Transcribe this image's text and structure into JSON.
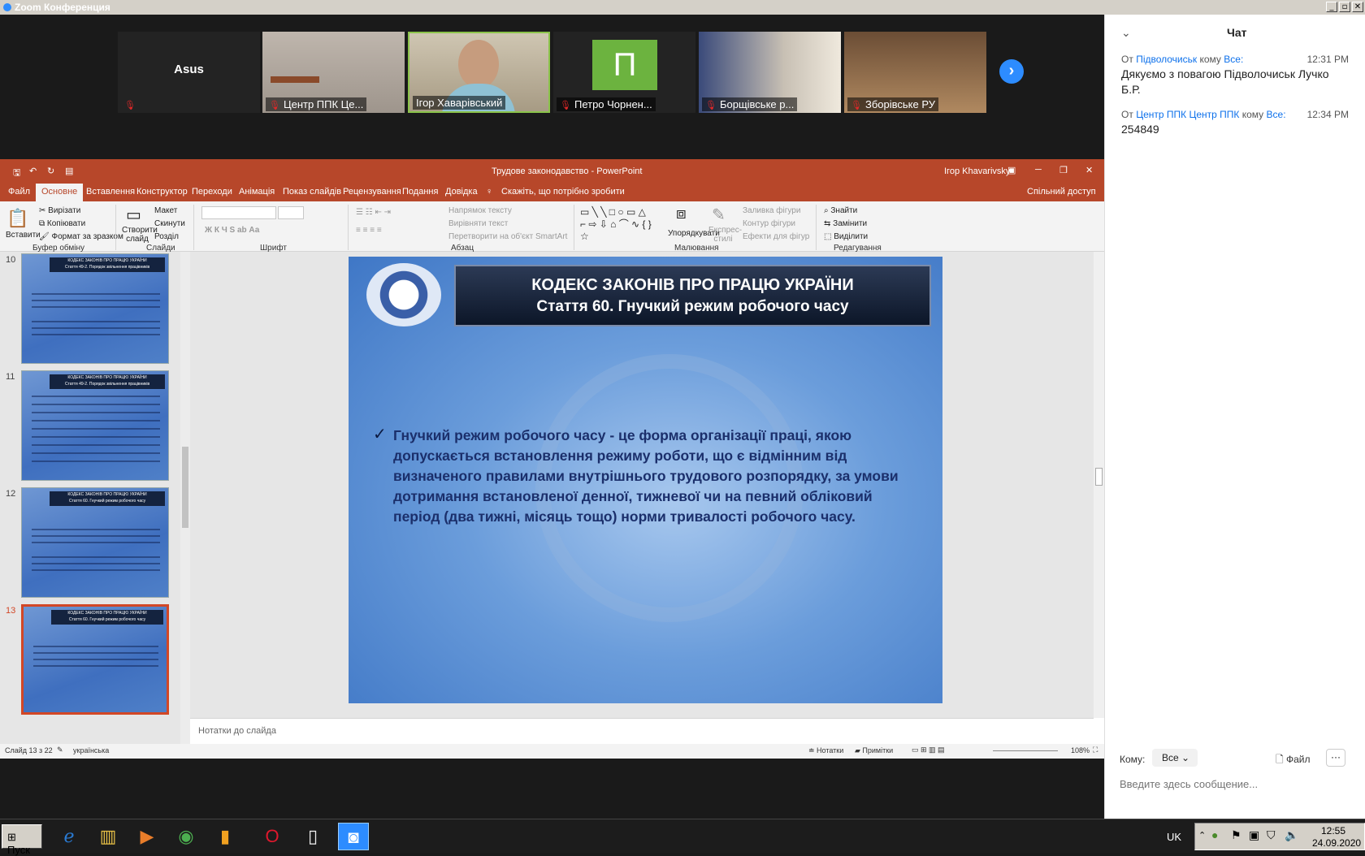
{
  "zoom": {
    "title": "Zoom Конференция",
    "participants": [
      {
        "name": "Asus",
        "muted": true
      },
      {
        "name": "Центр ППК Це...",
        "muted": true
      },
      {
        "name": "Ігор Хаварівський",
        "muted": false
      },
      {
        "name": "Петро Чорнен...",
        "muted": true,
        "initial": "П"
      },
      {
        "name": "Борщівське р...",
        "muted": true
      },
      {
        "name": "Зборівське РУ",
        "muted": true
      }
    ]
  },
  "ppt": {
    "title": "Трудове законодавство  -  PowerPoint",
    "user": "Ігор Khavarivsky",
    "tabs": [
      "Файл",
      "Основне",
      "Вставлення",
      "Конструктор",
      "Переходи",
      "Анімація",
      "Показ слайдів",
      "Рецензування",
      "Подання",
      "Довідка"
    ],
    "tell_me": "Скажіть, що потрібно зробити",
    "share": "Спільний доступ",
    "ribbon": {
      "paste": "Вставити",
      "cut": "Вирізати",
      "copy": "Копіювати",
      "format_painter": "Формат за зразком",
      "new_slide": "Створити слайд",
      "layout": "Макет",
      "reset": "Скинути",
      "section": "Розділ",
      "text_direction": "Напрямок тексту",
      "align_text": "Вирівняти текст",
      "convert_smartart": "Перетворити на об'єкт SmartArt",
      "arrange": "Упорядкувати",
      "quick_styles": "Експрес-стилі",
      "shape_fill": "Заливка фігури",
      "shape_outline": "Контур фігури",
      "shape_effects": "Ефекти для фігур",
      "find": "Знайти",
      "replace": "Замінити",
      "select": "Виділити",
      "groups": [
        "Буфер обміну",
        "Слайди",
        "Шрифт",
        "Абзац",
        "Малювання",
        "Редагування"
      ]
    },
    "thumbnails": [
      {
        "num": "10",
        "title1": "КОДЕКС ЗАКОНІВ ПРО ПРАЦЮ УКРАЇНИ",
        "title2": "Стаття 49-2. Порядок звільнення працівників"
      },
      {
        "num": "11",
        "title1": "КОДЕКС ЗАКОНІВ ПРО ПРАЦЮ УКРАЇНИ",
        "title2": "Стаття 49-2. Порядок звільнення працівників"
      },
      {
        "num": "12",
        "title1": "КОДЕКС ЗАКОНІВ ПРО ПРАЦЮ УКРАЇНИ",
        "title2": "Стаття 60. Гнучкий режим робочого часу"
      },
      {
        "num": "13",
        "title1": "КОДЕКС ЗАКОНІВ ПРО ПРАЦЮ УКРАЇНИ",
        "title2": "Стаття 60. Гнучкий режим робочого часу"
      }
    ],
    "slide": {
      "title1": "КОДЕКС ЗАКОНІВ ПРО ПРАЦЮ УКРАЇНИ",
      "title2": "Стаття 60. Гнучкий режим робочого часу",
      "body": "Гнучкий режим робочого часу - це форма організації праці, якою допускається встановлення режиму роботи, що є відмінним від визначеного правилами внутрішнього трудового розпорядку, за умови дотримання встановленої денної, тижневої чи на певний обліковий період (два тижні, місяць тощо) норми тривалості робочого часу."
    },
    "notes_placeholder": "Нотатки до слайда",
    "status": {
      "slide": "Слайд 13 з 22",
      "language": "українська",
      "notes": "Нотатки",
      "comments": "Примітки",
      "zoom": "108%"
    }
  },
  "chat": {
    "title": "Чат",
    "messages": [
      {
        "from_label": "От",
        "from": "Підволочиськ",
        "to_label": "кому",
        "to": "Все:",
        "time": "12:31 PM",
        "text": "Дякуємо з повагою Підволочиськ Лучко Б.Р."
      },
      {
        "from_label": "От",
        "from": "Центр ППК Центр ППК",
        "to_label": "кому",
        "to": "Все:",
        "time": "12:34 PM",
        "text": "254849"
      }
    ],
    "to_label": "Кому:",
    "to_value": "Все",
    "file_label": "Файл",
    "input_placeholder": "Введите здесь сообщение..."
  },
  "taskbar": {
    "start": "Пуск",
    "lang": "UK",
    "time": "12:55",
    "date": "24.09.2020"
  }
}
